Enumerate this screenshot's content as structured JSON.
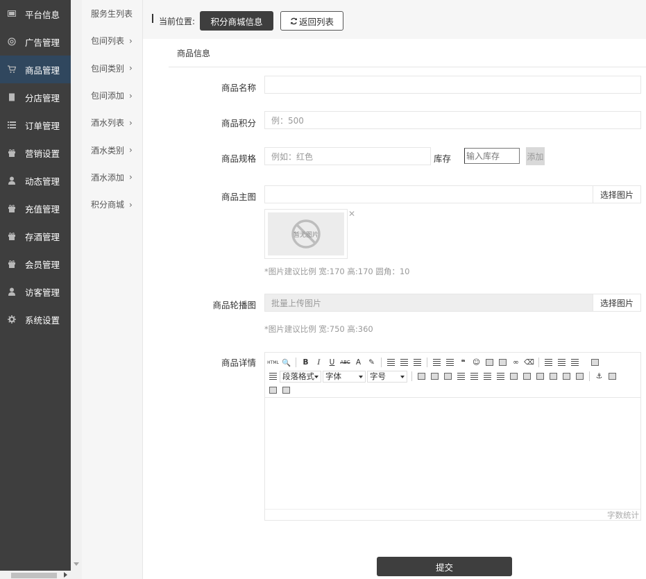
{
  "sidebar": {
    "items": [
      {
        "label": "平台信息",
        "icon": "monitor-icon"
      },
      {
        "label": "广告管理",
        "icon": "globe-icon"
      },
      {
        "label": "商品管理",
        "icon": "cart-icon",
        "active": true
      },
      {
        "label": "分店管理",
        "icon": "building-icon"
      },
      {
        "label": "订单管理",
        "icon": "list-icon"
      },
      {
        "label": "营销设置",
        "icon": "gift-icon"
      },
      {
        "label": "动态管理",
        "icon": "user-icon"
      },
      {
        "label": "充值管理",
        "icon": "gift-icon"
      },
      {
        "label": "存酒管理",
        "icon": "gift-icon"
      },
      {
        "label": "会员管理",
        "icon": "gift-icon"
      },
      {
        "label": "访客管理",
        "icon": "user-icon"
      },
      {
        "label": "系统设置",
        "icon": "gear-icon"
      }
    ]
  },
  "subnav": {
    "items": [
      {
        "label": "服务生列表",
        "chevron": ""
      },
      {
        "label": "包间列表",
        "chevron": "›"
      },
      {
        "label": "包间类别",
        "chevron": "›"
      },
      {
        "label": "包间添加",
        "chevron": "›"
      },
      {
        "label": "酒水列表",
        "chevron": "›"
      },
      {
        "label": "酒水类别",
        "chevron": "›"
      },
      {
        "label": "酒水添加",
        "chevron": "›"
      },
      {
        "label": "积分商城",
        "chevron": "›"
      }
    ]
  },
  "topbar": {
    "location_label": "当前位置:",
    "current_button": "积分商城信息",
    "back_button": "返回列表"
  },
  "panel": {
    "title": "商品信息"
  },
  "form": {
    "name_label": "商品名称",
    "name_value": "",
    "points_label": "商品积分",
    "points_placeholder": "例：500",
    "spec_label": "商品规格",
    "spec_placeholder": "例如：红色",
    "stock_label": "库存",
    "stock_placeholder": "输入库存",
    "add_button": "添加",
    "main_image_label": "商品主图",
    "main_image_value": "",
    "pick_image_button": "选择图片",
    "no_image_text": "暂无图片",
    "close_glyph": "✕",
    "main_image_hint": "*图片建议比例 宽:170 高:170 圆角：10",
    "carousel_label": "商品轮播图",
    "carousel_placeholder": "批量上传图片",
    "carousel_pick_button": "选择图片",
    "carousel_hint": "*图片建议比例 宽:750 高:360",
    "detail_label": "商品详情",
    "submit_button": "提交"
  },
  "editor": {
    "paragraph_select": "段落格式",
    "font_select": "字体",
    "size_select": "字号",
    "word_count": "字数统计",
    "toolbar_text": {
      "html": "HTML",
      "bold": "B",
      "italic": "I",
      "underline": "U",
      "strike": "ABC",
      "font_color": "A",
      "quote": "❝"
    }
  },
  "colors": {
    "sidebar_bg": "#3e3e3e",
    "sidebar_active": "#30475e",
    "button_dark": "#3e3e3e",
    "add_button_bg": "#d9d9d9"
  }
}
